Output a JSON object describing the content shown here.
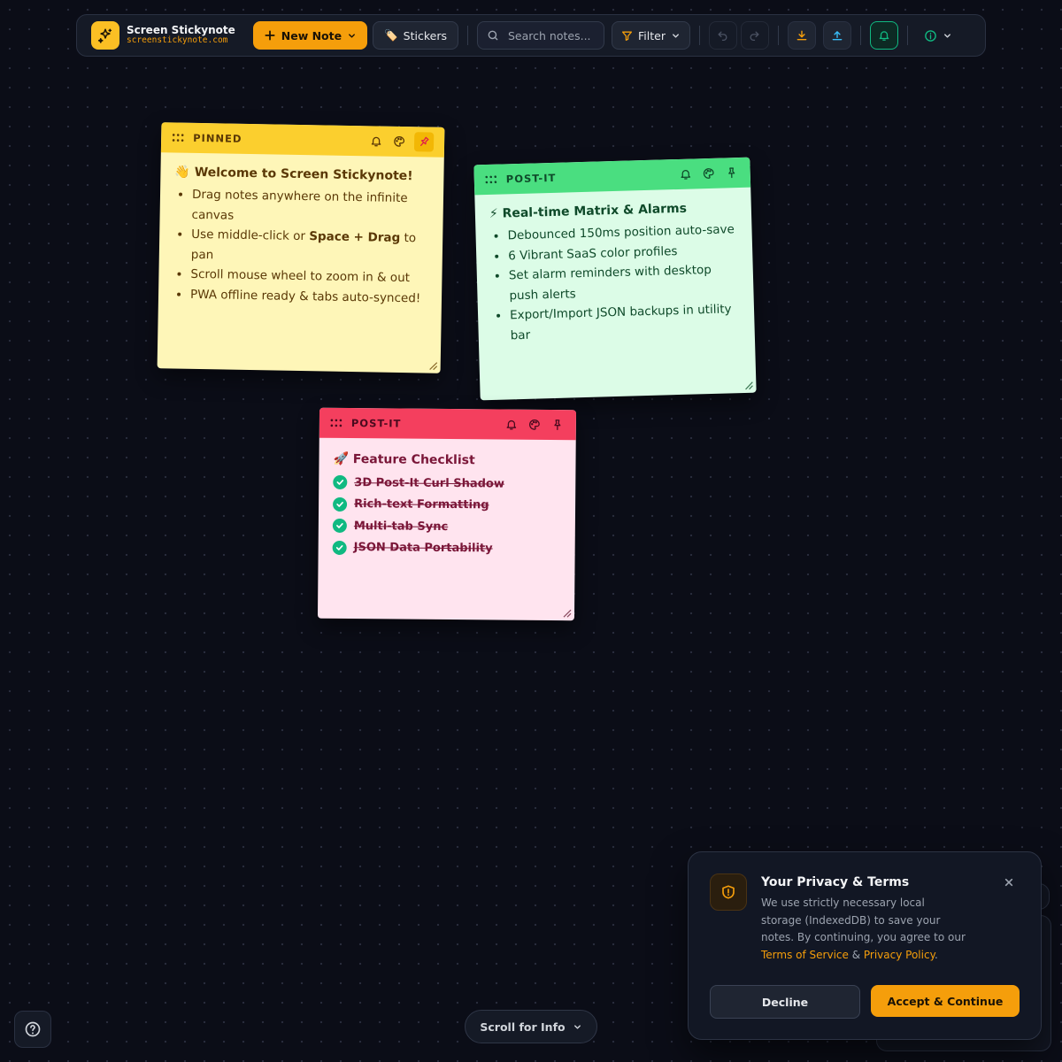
{
  "app": {
    "name": "Screen Stickynote",
    "domain": "screenstickynote.com"
  },
  "toolbar": {
    "new_note_label": "New Note",
    "stickers_label": "Stickers",
    "stickers_emoji": "🏷️",
    "search_placeholder": "Search notes...",
    "filter_label": "Filter",
    "icons": [
      "sparkle-logo-icon",
      "plus-icon",
      "chevron-down-icon",
      "tag-icon",
      "search-icon",
      "filter-icon",
      "undo-icon",
      "redo-icon",
      "download-icon",
      "upload-icon",
      "bell-icon",
      "info-icon"
    ]
  },
  "notes": [
    {
      "tag": "PINNED",
      "title": "👋 Welcome to Screen Stickynote!",
      "items": [
        "Drag notes anywhere on the infinite canvas",
        "Use middle-click or ",
        "Space + Drag",
        " to pan",
        "Scroll mouse wheel to zoom in & out",
        "PWA offline ready & tabs auto-synced!"
      ],
      "colors": {
        "header": "#fbcf2e",
        "body": "#fef6b8",
        "text": "#5a3806"
      }
    },
    {
      "tag": "POST-IT",
      "title": "⚡ Real-time Matrix & Alarms",
      "items": [
        "Debounced 150ms position auto-save",
        "6 Vibrant SaaS color profiles",
        "Set alarm reminders with desktop push alerts",
        "Export/Import JSON backups in utility bar"
      ],
      "colors": {
        "header": "#4ade80",
        "body": "#dcfce7",
        "text": "#0f4a2a"
      }
    },
    {
      "tag": "POST-IT",
      "title": "🚀 Feature Checklist",
      "checklist": [
        "3D Post-It Curl Shadow",
        "Rich-text Formatting",
        "Multi-tab Sync",
        "JSON Data Portability"
      ],
      "colors": {
        "header": "#f43f5e",
        "body": "#ffe4ef",
        "text": "#7a1638"
      }
    }
  ],
  "privacy": {
    "title": "Your Privacy & Terms",
    "text_before": "We use strictly necessary local storage (IndexedDB) to save your notes. By continuing, you agree to our ",
    "terms_link": "Terms of Service",
    "amp": " & ",
    "privacy_link": "Privacy Policy",
    "text_after": ".",
    "decline_label": "Decline",
    "accept_label": "Accept & Continue"
  },
  "bottom": {
    "scroll_info_label": "Scroll for Info"
  },
  "colors": {
    "accent": "#f59e0b",
    "success": "#10b981",
    "background": "#0b0d17"
  }
}
